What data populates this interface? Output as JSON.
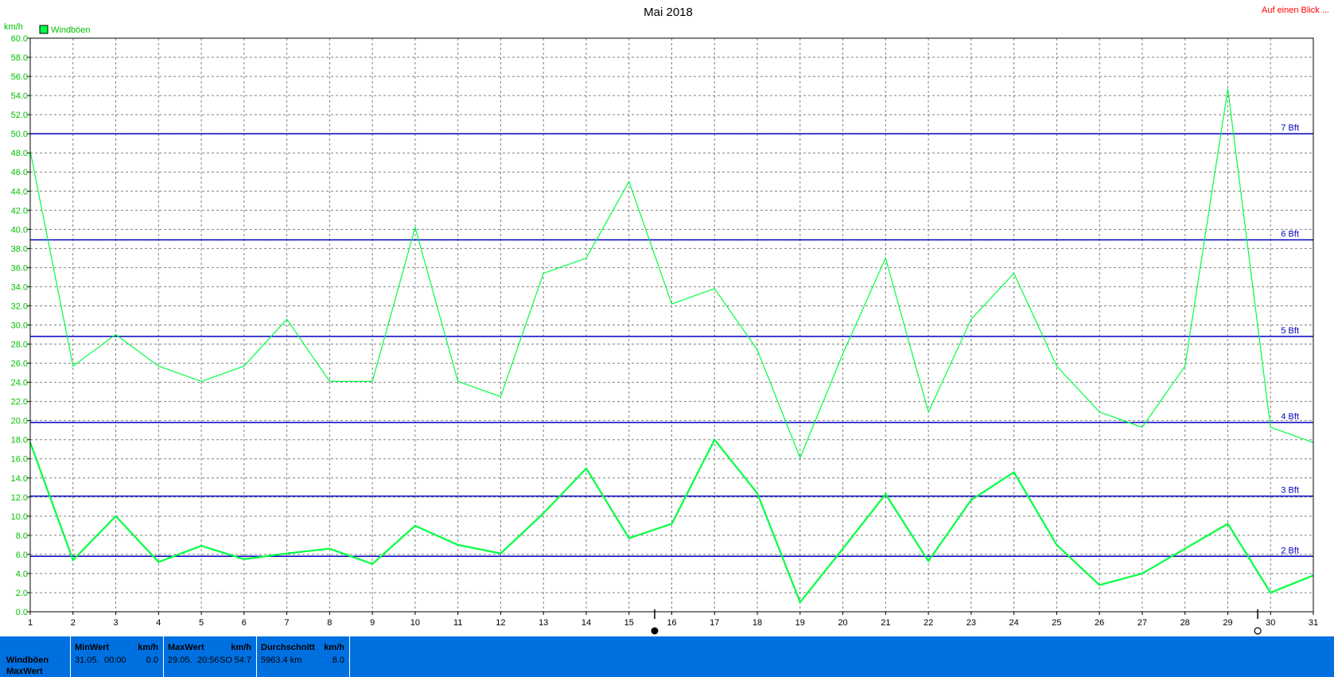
{
  "header": {
    "title": "Mai 2018",
    "link_label": "Auf einen Blick ..."
  },
  "colors": {
    "series": "#00ff40",
    "grid": "#808080",
    "beaufort_lines": "#0000c0",
    "footer_bg": "#0070e0"
  },
  "chart_data": {
    "type": "line",
    "ylabel": "km/h",
    "ylim": [
      0,
      60
    ],
    "ytick_step": 2,
    "xlim": [
      1,
      31
    ],
    "grid": true,
    "legend": {
      "placement": "top-left",
      "entries": [
        "Windböen"
      ]
    },
    "x": [
      1,
      2,
      3,
      4,
      5,
      6,
      7,
      8,
      9,
      10,
      11,
      12,
      13,
      14,
      15,
      16,
      17,
      18,
      19,
      20,
      21,
      22,
      23,
      24,
      25,
      26,
      27,
      28,
      29,
      30,
      31
    ],
    "series": [
      {
        "name": "Windböen",
        "role": "max",
        "values": [
          48.2,
          25.7,
          29.0,
          25.7,
          24.1,
          25.7,
          30.6,
          24.1,
          24.1,
          40.2,
          24.1,
          22.5,
          35.4,
          37.0,
          45.0,
          32.2,
          33.8,
          27.4,
          16.1,
          27.0,
          37.0,
          20.9,
          30.6,
          35.4,
          25.7,
          20.9,
          19.3,
          25.7,
          54.7,
          19.3,
          17.7
        ]
      },
      {
        "name": "Windböen",
        "role": "mean",
        "values": [
          17.7,
          5.4,
          10.0,
          5.2,
          6.9,
          5.5,
          6.1,
          6.6,
          5.0,
          9.0,
          7.0,
          6.1,
          10.3,
          15.0,
          7.7,
          9.2,
          18.0,
          12.4,
          1.0,
          6.6,
          12.3,
          5.3,
          11.7,
          14.6,
          7.0,
          2.8,
          4.0,
          6.6,
          9.2,
          2.0,
          3.8
        ]
      }
    ],
    "reference_lines": [
      {
        "label": "7 Bft",
        "value": 50.0
      },
      {
        "label": "6 Bft",
        "value": 38.9
      },
      {
        "label": "5 Bft",
        "value": 28.8
      },
      {
        "label": "4 Bft",
        "value": 19.8
      },
      {
        "label": "3 Bft",
        "value": 12.1
      },
      {
        "label": "2 Bft",
        "value": 5.8
      }
    ],
    "moon_phases": [
      {
        "symbol": "full-moon",
        "day": 15.6
      },
      {
        "symbol": "new-moon",
        "day": 29.7
      }
    ]
  },
  "footer": {
    "row_label_1": "Windböen",
    "row_label_2": "MaxWert",
    "min": {
      "header": "MinWert",
      "unit": "km/h",
      "date": "31.05.",
      "time": "00:00",
      "value": "0.0"
    },
    "max": {
      "header": "MaxWert",
      "unit": "km/h",
      "date": "29.05.",
      "time": "20:56",
      "dir": "SO",
      "value": "54.7"
    },
    "avg": {
      "header": "Durchschnitt",
      "unit": "km/h",
      "distance": "5963.4 km",
      "value": "8.0"
    }
  }
}
